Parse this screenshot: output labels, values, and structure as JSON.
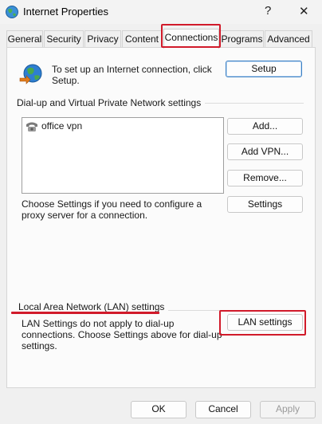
{
  "window": {
    "title": "Internet Properties",
    "help_glyph": "?",
    "close_glyph": "✕"
  },
  "tabs": [
    {
      "label": "General"
    },
    {
      "label": "Security"
    },
    {
      "label": "Privacy"
    },
    {
      "label": "Content"
    },
    {
      "label": "Connections",
      "active": true
    },
    {
      "label": "Programs"
    },
    {
      "label": "Advanced"
    }
  ],
  "setup": {
    "text": "To set up an Internet connection, click Setup.",
    "button": "Setup"
  },
  "dialup": {
    "group_label": "Dial-up and Virtual Private Network settings",
    "connections": [
      "office vpn"
    ],
    "add_button": "Add...",
    "add_vpn_button": "Add VPN...",
    "remove_button": "Remove...",
    "proxy_text": "Choose Settings if you need to configure a proxy server for a connection.",
    "settings_button": "Settings"
  },
  "lan": {
    "group_label": "Local Area Network (LAN) settings",
    "text": "LAN Settings do not apply to dial-up connections. Choose Settings above for dial-up settings.",
    "button": "LAN settings"
  },
  "footer": {
    "ok": "OK",
    "cancel": "Cancel",
    "apply": "Apply"
  },
  "colors": {
    "highlight": "#d11a2a",
    "primary_border": "#3b7fc4"
  }
}
